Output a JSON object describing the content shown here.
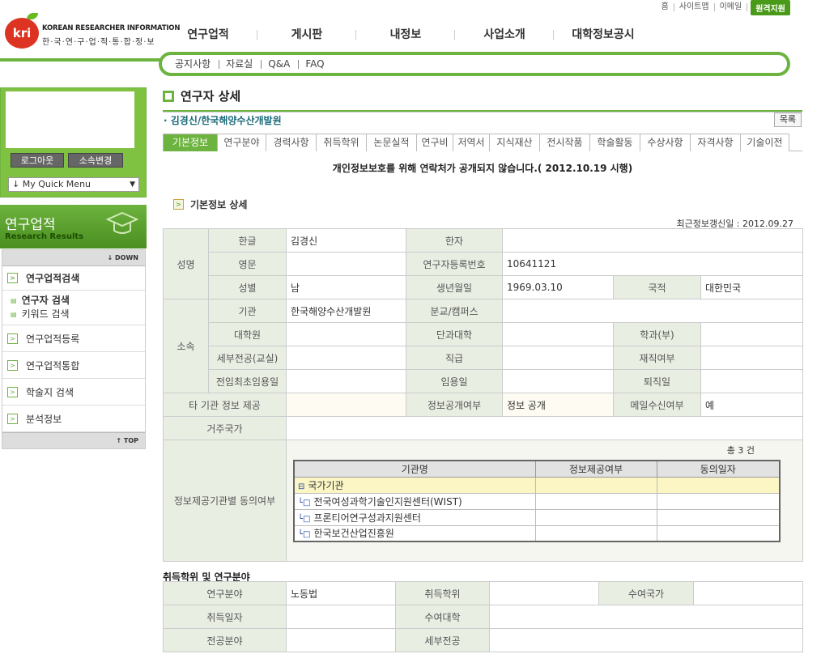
{
  "topbar": {
    "home": "홈",
    "sitemap": "사이트맵",
    "email": "이메일",
    "remote": "원격지원"
  },
  "logo": {
    "mark": "kri",
    "en": "KOREAN RESEARCHER INFORMATION",
    "kr": "한·국·연·구·업·적·통·합·정·보"
  },
  "gnb": [
    "연구업적",
    "게시판",
    "내정보",
    "사업소개",
    "대학정보공시"
  ],
  "lnb": [
    "공지사항",
    "자료실",
    "Q&A",
    "FAQ"
  ],
  "login": {
    "logout": "로그아웃",
    "change_dept": "소속변경",
    "quick_menu": "↓ My Quick Menu"
  },
  "section": {
    "title_kr": "연구업적",
    "title_en": "Research Results"
  },
  "sidemenu": {
    "down": "DOWN",
    "top": "TOP",
    "search": "연구업적검색",
    "sub_researcher": "연구자 검색",
    "sub_keyword": "키워드 검색",
    "register": "연구업적등록",
    "integrate": "연구업적통합",
    "journal": "학술지 검색",
    "analysis": "분석정보"
  },
  "page": {
    "title": "연구자 상세",
    "person": "김경신/한국해양수산개발원",
    "list_button": "목록",
    "notice": "개인정보보호를 위해 연락처가 공개되지 않습니다.( 2012.10.19 시행)",
    "sub_heading": "기본정보 상세",
    "updated": "최근정보갱신일 :   2012.09.27"
  },
  "tabs": [
    {
      "label": "기본정보",
      "w": 68
    },
    {
      "label": "연구분야",
      "w": 61
    },
    {
      "label": "경력사항",
      "w": 63
    },
    {
      "label": "취득학위",
      "w": 63
    },
    {
      "label": "논문실적",
      "w": 63
    },
    {
      "label": "연구비",
      "w": 46
    },
    {
      "label": "저역서",
      "w": 46
    },
    {
      "label": "지식재산",
      "w": 63
    },
    {
      "label": "전시작품",
      "w": 63
    },
    {
      "label": "학술활동",
      "w": 63
    },
    {
      "label": "수상사항",
      "w": 63
    },
    {
      "label": "자격사항",
      "w": 63
    },
    {
      "label": "기술이전",
      "w": 61
    }
  ],
  "basic": {
    "name_group": "성명",
    "hangul_label": "한글",
    "hangul": "김경신",
    "hanja_label": "한자",
    "hanja": "",
    "english_label": "영문",
    "english": "",
    "reg_no_label": "연구자등록번호",
    "reg_no": "10641121",
    "gender_label": "성별",
    "gender": "남",
    "birth_label": "생년월일",
    "birth": "1969.03.10",
    "nation_label": "국적",
    "nation": "대한민국",
    "affil_group": "소속",
    "inst_label": "기관",
    "inst": "한국해양수산개발원",
    "campus_label": "분교/캠퍼스",
    "campus": "",
    "grad_label": "대학원",
    "grad": "",
    "college_label": "단과대학",
    "college": "",
    "dept_label": "학과(부)",
    "dept": "",
    "major_label": "세부전공(교실)",
    "major": "",
    "rank_label": "직급",
    "rank": "",
    "employed_label": "재직여부",
    "employed": "",
    "first_hire_label": "전임최초임용일",
    "first_hire": "",
    "hire_label": "임용일",
    "hire": "",
    "retire_label": "퇴직일",
    "retire": "",
    "other_inst_label": "타 기관 정보 제공",
    "other_inst": "",
    "disclose_label": "정보공개여부",
    "disclose": "정보 공개",
    "mail_label": "메일수신여부",
    "mail": "예",
    "residence_label": "거주국가",
    "residence": "",
    "consent_label": "정보제공기관별 동의여부"
  },
  "consent": {
    "count": "총 3 건",
    "headers": [
      "기관명",
      "정보제공여부",
      "동의일자"
    ],
    "group": "국가기관",
    "rows": [
      "전국여성과학기술인지원센터(WIST)",
      "프론티어연구성과지원센터",
      "한국보건산업진흥원"
    ]
  },
  "degree": {
    "section": "취득학위 및 연구분야",
    "field_label": "연구분야",
    "field": "노동법",
    "degree_label": "취득학위",
    "degree": "",
    "country_label": "수여국가",
    "country": "",
    "date_label": "취득일자",
    "date": "",
    "univ_label": "수여대학",
    "univ": "",
    "major_label": "전공분야",
    "major": "",
    "detail_label": "세부전공",
    "detail": ""
  }
}
